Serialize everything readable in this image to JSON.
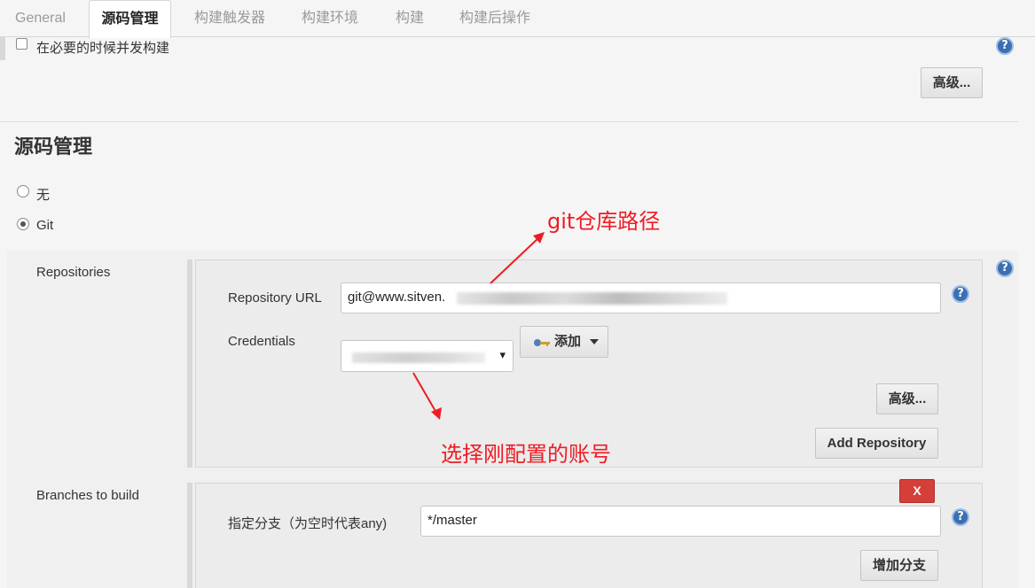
{
  "tabs": [
    "General",
    "源码管理",
    "构建触发器",
    "构建环境",
    "构建",
    "构建后操作"
  ],
  "general": {
    "concurrent_label": "在必要的时候并发构建",
    "advanced_label": "高级..."
  },
  "scm": {
    "title": "源码管理",
    "options": [
      "无",
      "Git"
    ],
    "selected": "Git",
    "repositories_label": "Repositories",
    "repo_url_label": "Repository URL",
    "repo_url_value": "git@www.sitven.",
    "credentials_label": "Credentials",
    "credentials_arrow": "▾",
    "add_label": "添加",
    "advanced_label": "高级...",
    "add_repo_label": "Add Repository",
    "branches_label": "Branches to build",
    "delete_label": "X",
    "branch_spec_label": "指定分支（为空时代表any)",
    "branch_spec_value": "*/master",
    "add_branch_label": "增加分支"
  },
  "annotations": {
    "git_path": "git仓库路径",
    "select_account": "选择刚配置的账号"
  },
  "colors": {
    "annotation": "#ee1c24",
    "help_icon": "#3b6fb3",
    "delete_button": "#d43f3a"
  }
}
